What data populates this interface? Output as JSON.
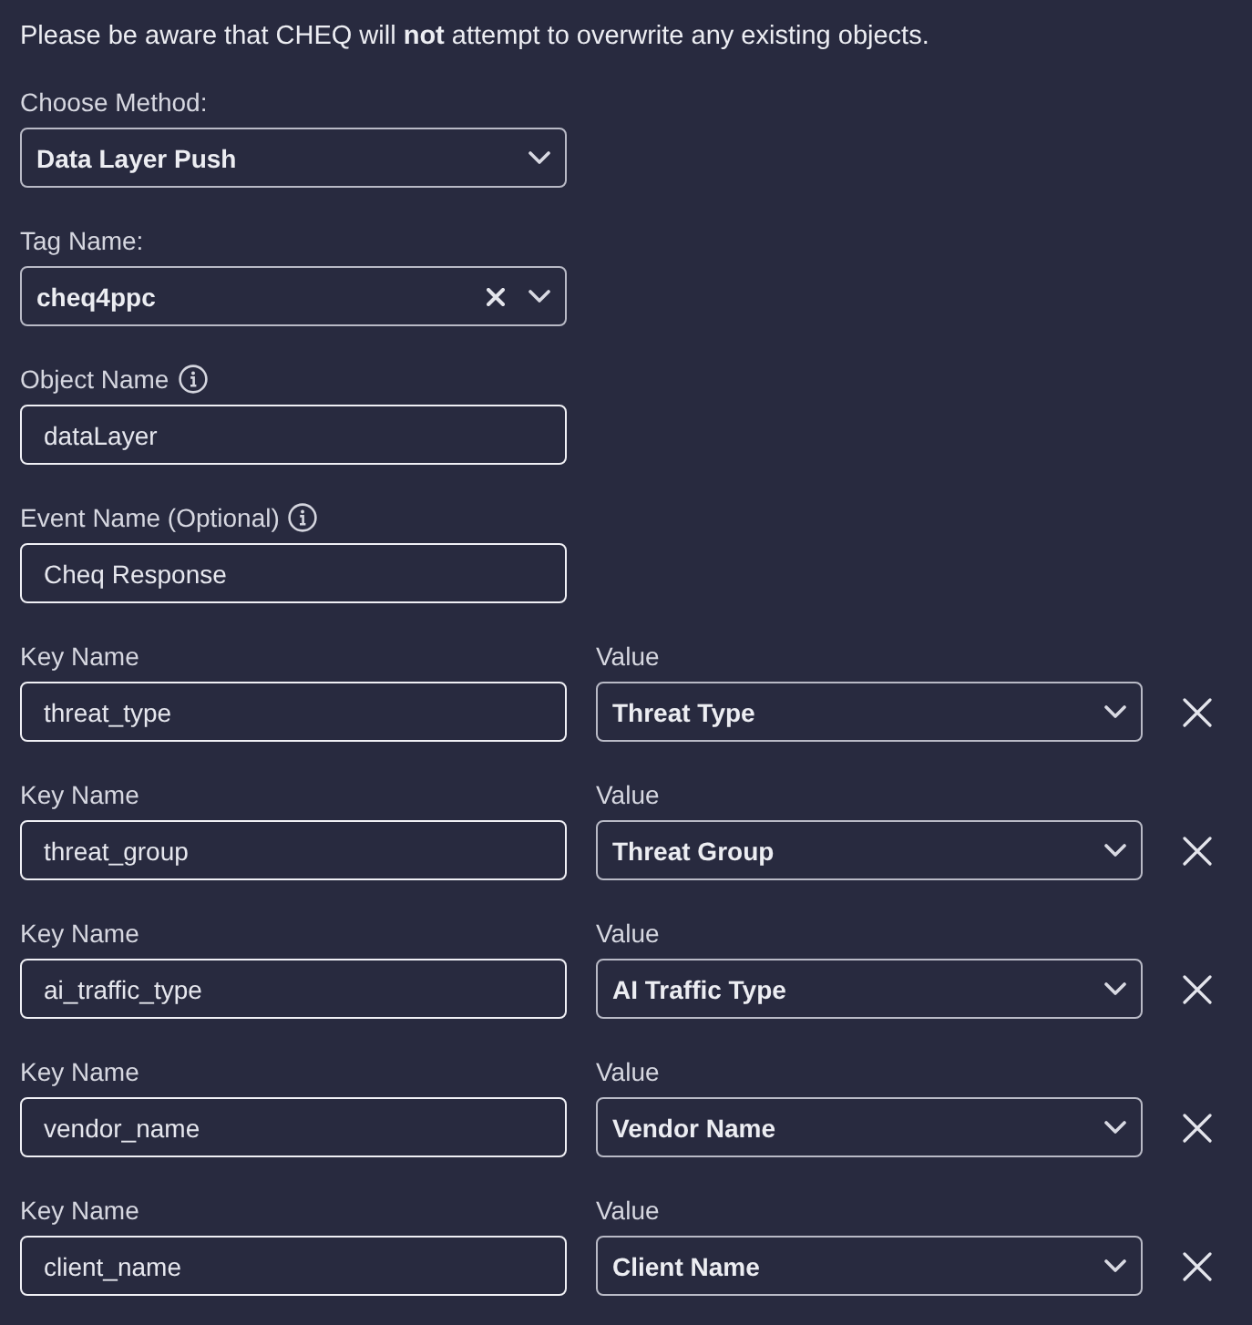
{
  "notice": "Please be aware that CHEQ will **not** attempt to overwrite any existing objects.",
  "fields": [
    {
      "kind": "select",
      "label": "Choose Method:",
      "value": "Data Layer Push",
      "info": false,
      "clearable": false
    },
    {
      "kind": "select",
      "label": "Tag Name:",
      "value": "cheq4ppc",
      "info": false,
      "clearable": true
    },
    {
      "kind": "input",
      "label": "Object Name",
      "value": "dataLayer",
      "info": true,
      "clearable": false
    },
    {
      "kind": "input",
      "label": "Event Name (Optional)",
      "value": "Cheq Response",
      "info": true,
      "clearable": false
    }
  ],
  "mappings": [
    {
      "key_label": "Key Name",
      "key": "threat_type",
      "value_label": "Value",
      "value": "Threat Type"
    },
    {
      "key_label": "Key Name",
      "key": "threat_group",
      "value_label": "Value",
      "value": "Threat Group"
    },
    {
      "key_label": "Key Name",
      "key": "ai_traffic_type",
      "value_label": "Value",
      "value": "AI Traffic Type"
    },
    {
      "key_label": "Key Name",
      "key": "vendor_name",
      "value_label": "Value",
      "value": "Vendor Name"
    },
    {
      "key_label": "Key Name",
      "key": "client_name",
      "value_label": "Value",
      "value": "Client Name"
    }
  ]
}
